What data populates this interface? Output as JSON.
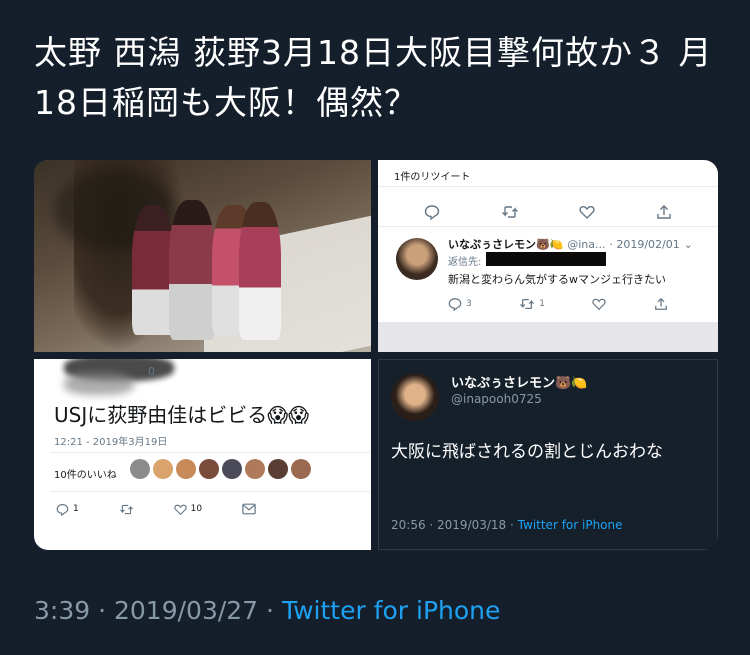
{
  "tweet": {
    "text": "太野 西潟 荻野3月18日大阪目撃何故か３ 月18日稲岡も大阪！偶然？",
    "time": "3:39",
    "sep": "·",
    "date": "2019/03/27",
    "source": "Twitter for iPhone"
  },
  "media": {
    "screenshot_reply": {
      "retweet_count_label": "1件のリツイート",
      "author_name": "いなぷぅさレモン",
      "author_emoji": "🐻🍋",
      "author_handle": "@ina...",
      "date": "· 2019/02/01",
      "reply_label": "返信先:",
      "body": "新潟と変わらん気がするwマンジェ行きたい",
      "reply_count": "3",
      "retweet_count": "1"
    },
    "screenshot_usj": {
      "partial_top": "0",
      "body": "USJに荻野由佳はビビる",
      "body_emoji": "😱😱",
      "timestamp": "12:21 - 2019年3月19日",
      "likes_label": "10件のいいね",
      "reply_count": "1",
      "like_count": "10"
    },
    "screenshot_osaka": {
      "author_name": "いなぷぅさレモン🐻🍋",
      "author_handle": "@inapooh0725",
      "body": "大阪に飛ばされるの割とじんおわな",
      "time_date": "20:56 · 2019/03/18 ·",
      "source": "Twitter for iPhone"
    }
  },
  "icons": [
    "reply-icon",
    "retweet-icon",
    "like-icon",
    "share-icon",
    "mail-icon",
    "chevron-down-icon"
  ],
  "colors": {
    "background": "#151f2b",
    "link": "#1da1f2",
    "muted": "#8899a6"
  }
}
